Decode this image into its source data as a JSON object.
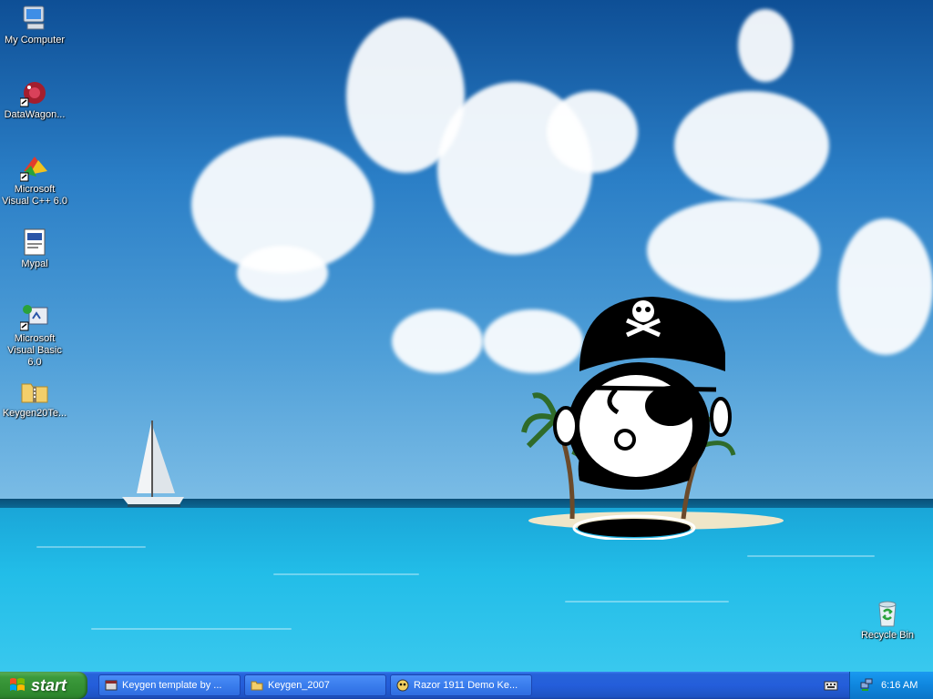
{
  "desktop": {
    "icons": [
      {
        "label": "My Computer",
        "icon": "my-computer-icon"
      },
      {
        "label": "DataWagon...",
        "icon": "datawagon-icon"
      },
      {
        "label": "Microsoft Visual C++ 6.0",
        "icon": "visual-cpp-icon"
      },
      {
        "label": "Mypal",
        "icon": "mypal-document-icon"
      },
      {
        "label": "Microsoft Visual Basic 6.0",
        "icon": "visual-basic-icon"
      },
      {
        "label": "Keygen20Te...",
        "icon": "zip-folder-icon"
      }
    ],
    "recycle_bin": {
      "label": "Recycle Bin",
      "icon": "recycle-bin-icon"
    },
    "wallpaper": "tropical-island-sea-with-sailboat",
    "overlay": "pirate-character-with-eyepatch"
  },
  "taskbar": {
    "start_label": "start",
    "tasks": [
      {
        "label": "Keygen template by ...",
        "icon": "app-window-icon"
      },
      {
        "label": "Keygen_2007",
        "icon": "folder-icon"
      },
      {
        "label": "Razor 1911 Demo Ke...",
        "icon": "razor-app-icon"
      }
    ],
    "tray": {
      "time": "6:16 AM",
      "icons": [
        "keyboard-icon",
        "network-icon"
      ]
    }
  },
  "colors": {
    "taskbar": "#245edb",
    "start": "#3c9a3c",
    "tray": "#0f86de"
  }
}
